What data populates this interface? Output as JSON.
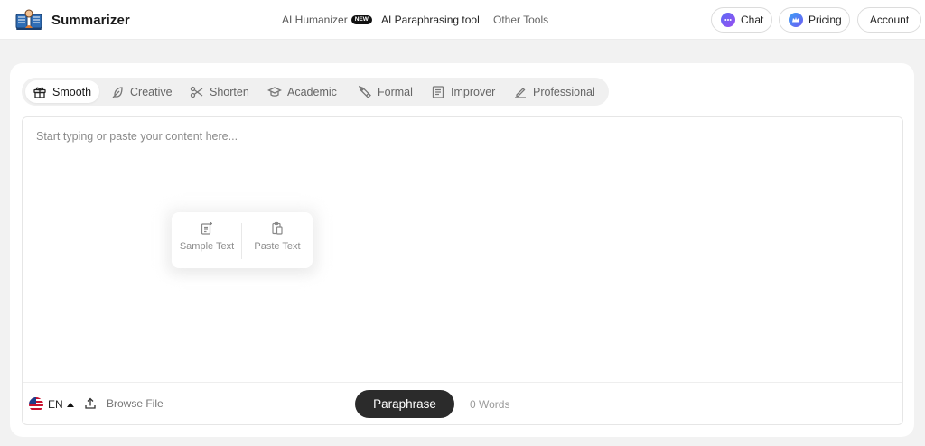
{
  "header": {
    "brand": "Summarizer",
    "logo_icon": "book-reader-icon",
    "nav": {
      "humanizer": "AI Humanizer",
      "humanizer_badge": "NEW",
      "paraphrasing": "AI Paraphrasing tool",
      "other_tools": "Other Tools"
    },
    "buttons": {
      "chat": "Chat",
      "pricing": "Pricing",
      "account": "Account"
    }
  },
  "modes": [
    {
      "label": "Smooth",
      "icon": "gift-icon",
      "active": true
    },
    {
      "label": "Creative",
      "icon": "feather-icon",
      "active": false
    },
    {
      "label": "Shorten",
      "icon": "scissors-icon",
      "active": false
    },
    {
      "label": "Academic",
      "icon": "graduation-cap-icon",
      "active": false
    },
    {
      "label": "Formal",
      "icon": "pen-tool-icon",
      "active": false
    },
    {
      "label": "Improver",
      "icon": "document-icon",
      "active": false
    },
    {
      "label": "Professional",
      "icon": "signature-icon",
      "active": false
    }
  ],
  "editor": {
    "placeholder": "Start typing or paste your content here...",
    "sample_text": "Sample Text",
    "paste_text": "Paste Text"
  },
  "footer": {
    "language": "EN",
    "browse_file": "Browse File",
    "paraphrase": "Paraphrase",
    "words": "0 Words"
  },
  "colors": {
    "primary_button": "#2b2b2b",
    "chat_icon_gradient": [
      "#5b6cf5",
      "#9a4df0"
    ],
    "pricing_icon_gradient": [
      "#3aa0f5",
      "#6f5cf3"
    ]
  }
}
